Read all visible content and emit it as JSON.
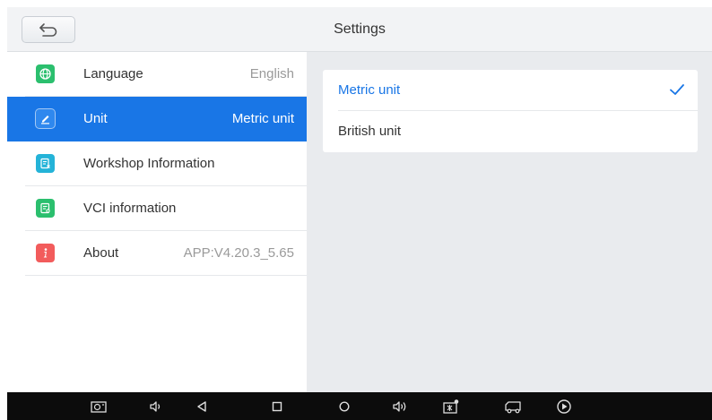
{
  "header": {
    "title": "Settings"
  },
  "sidebar": {
    "items": [
      {
        "label": "Language",
        "value": "English",
        "icon": "globe-icon",
        "color": "#2bbf6e"
      },
      {
        "label": "Unit",
        "value": "Metric unit",
        "icon": "edit-icon",
        "color": "#2f88ee",
        "active": true
      },
      {
        "label": "Workshop Information",
        "value": "",
        "icon": "document-icon",
        "color": "#24b3d8"
      },
      {
        "label": "VCI information",
        "value": "",
        "icon": "vci-doc-icon",
        "color": "#2bbf6e"
      },
      {
        "label": "About",
        "value": "APP:V4.20.3_5.65",
        "icon": "info-icon",
        "color": "#f25c5c"
      }
    ]
  },
  "unit_options": [
    {
      "label": "Metric unit",
      "selected": true
    },
    {
      "label": "British unit",
      "selected": false
    }
  ],
  "colors": {
    "accent": "#1976e6",
    "background": "#e9ebee",
    "navbar": "#0c0c0c"
  },
  "navbar": {
    "icons": [
      "screenshot-icon",
      "volume-down-icon",
      "back-icon",
      "recents-icon",
      "home-icon",
      "volume-up-icon",
      "vci-icon",
      "truck-icon",
      "play-icon"
    ]
  }
}
